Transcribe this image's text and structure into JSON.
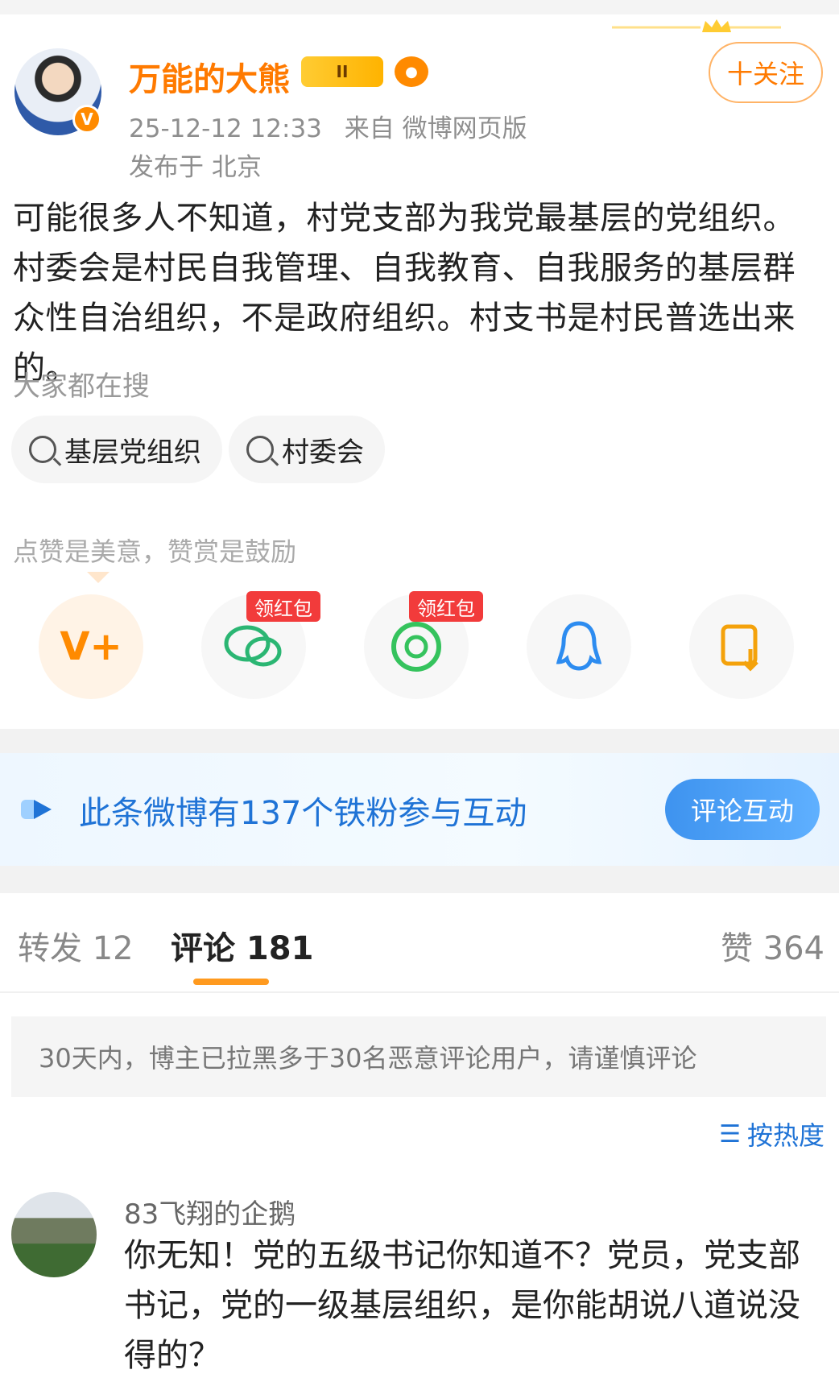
{
  "post": {
    "author": "万能的大熊",
    "timestamp": "25-12-12 12:33",
    "source": "来自 微博网页版",
    "location": "发布于 北京",
    "follow_label": "十关注",
    "text": "可能很多人不知道，村党支部为我党最基层的党组织。村委会是村民自我管理、自我教育、自我服务的基层群众性自治组织，不是政府组织。村支书是村民普选出来的。",
    "vip_badge_text": "II",
    "colors": {
      "accent": "#ff7a00",
      "link": "#1f73d6"
    }
  },
  "search": {
    "label": "大家都在搜",
    "chips": [
      "基层党组织",
      "村委会"
    ]
  },
  "reward": {
    "label": "点赞是美意，赞赏是鼓励",
    "share_buttons": [
      {
        "name": "reward-v-icon"
      },
      {
        "name": "wechat-icon",
        "tag": "领红包"
      },
      {
        "name": "moments-icon",
        "tag": "领红包"
      },
      {
        "name": "qq-icon"
      },
      {
        "name": "save-image-icon"
      }
    ]
  },
  "fans_banner": {
    "text": "此条微博有137个铁粉参与互动",
    "button": "评论互动"
  },
  "tabs": {
    "repost": "转发 12",
    "comments": "评论 181",
    "likes": "赞 364"
  },
  "notice": "30天内，博主已拉黑多于30名恶意评论用户，请谨慎评论",
  "sort": {
    "label": "按热度"
  },
  "comments": [
    {
      "user": "83飞翔的企鹅",
      "text": "你无知！党的五级书记你知道不？党员，党支部书记，党的一级基层组织，是你能胡说八道说没得的？"
    }
  ]
}
